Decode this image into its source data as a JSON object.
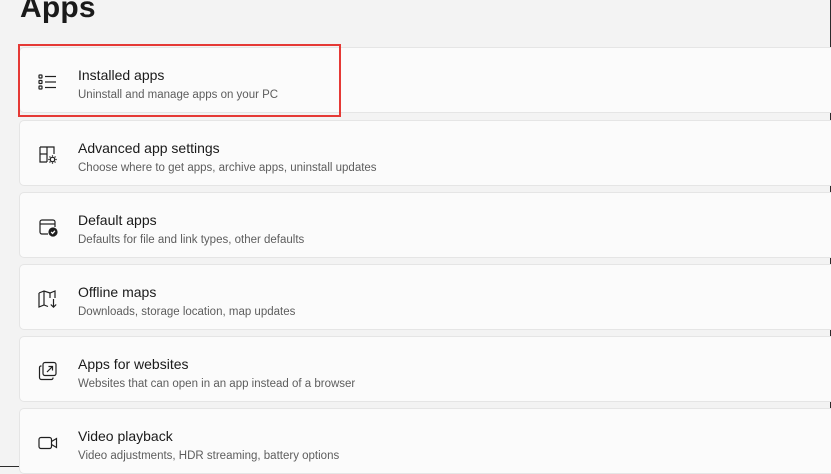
{
  "page": {
    "title": "Apps"
  },
  "items": [
    {
      "icon": "list-icon",
      "title": "Installed apps",
      "subtitle": "Uninstall and manage apps on your PC"
    },
    {
      "icon": "app-settings-icon",
      "title": "Advanced app settings",
      "subtitle": "Choose where to get apps, archive apps, uninstall updates"
    },
    {
      "icon": "default-apps-icon",
      "title": "Default apps",
      "subtitle": "Defaults for file and link types, other defaults"
    },
    {
      "icon": "map-icon",
      "title": "Offline maps",
      "subtitle": "Downloads, storage location, map updates"
    },
    {
      "icon": "open-in-app-icon",
      "title": "Apps for websites",
      "subtitle": "Websites that can open in an app instead of a browser"
    },
    {
      "icon": "video-camera-icon",
      "title": "Video playback",
      "subtitle": "Video adjustments, HDR streaming, battery options"
    }
  ],
  "colors": {
    "highlight": "#e53935",
    "background": "#f3f3f3",
    "card": "#fbfbfb"
  }
}
